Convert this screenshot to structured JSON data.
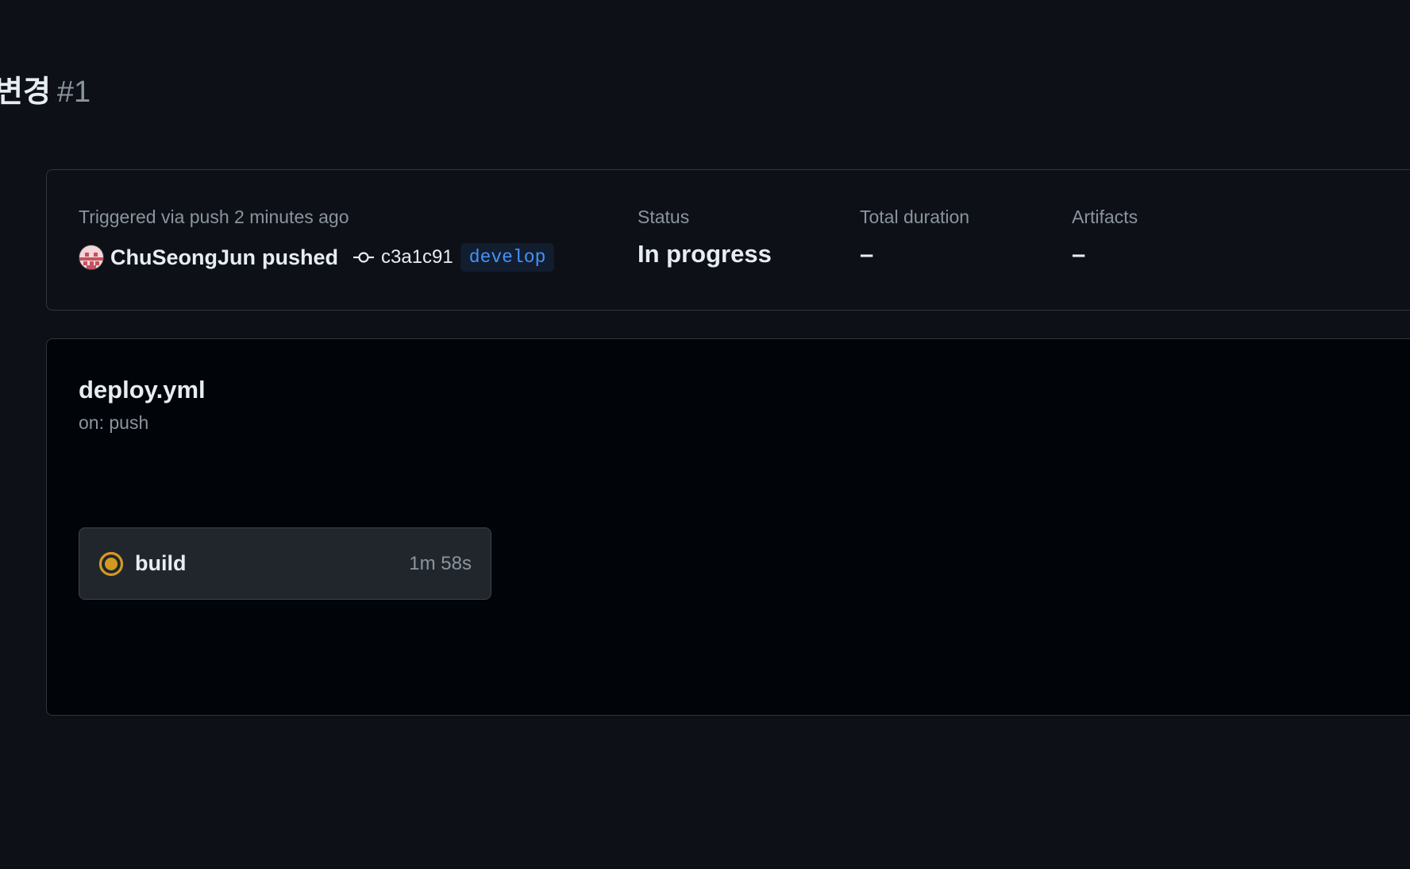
{
  "run": {
    "title_visible": "변경",
    "number": "#1"
  },
  "summary": {
    "trigger_text": "Triggered via push 2 minutes ago",
    "pusher": "ChuSeongJun",
    "action": "pushed",
    "commit_sha": "c3a1c91",
    "branch": "develop",
    "status_label": "Status",
    "status_value": "In progress",
    "duration_label": "Total duration",
    "duration_value": "–",
    "artifacts_label": "Artifacts",
    "artifacts_value": "–"
  },
  "workflow": {
    "file": "deploy.yml",
    "trigger": "on: push"
  },
  "jobs": [
    {
      "name": "build",
      "duration": "1m 58s",
      "status": "in-progress",
      "status_color": "#d29922"
    }
  ],
  "colors": {
    "background": "#0d1117",
    "graph_background": "#010409",
    "border": "#30363d",
    "muted_text": "#8b949e",
    "branch_text": "#4493f8",
    "in_progress": "#d29922"
  }
}
